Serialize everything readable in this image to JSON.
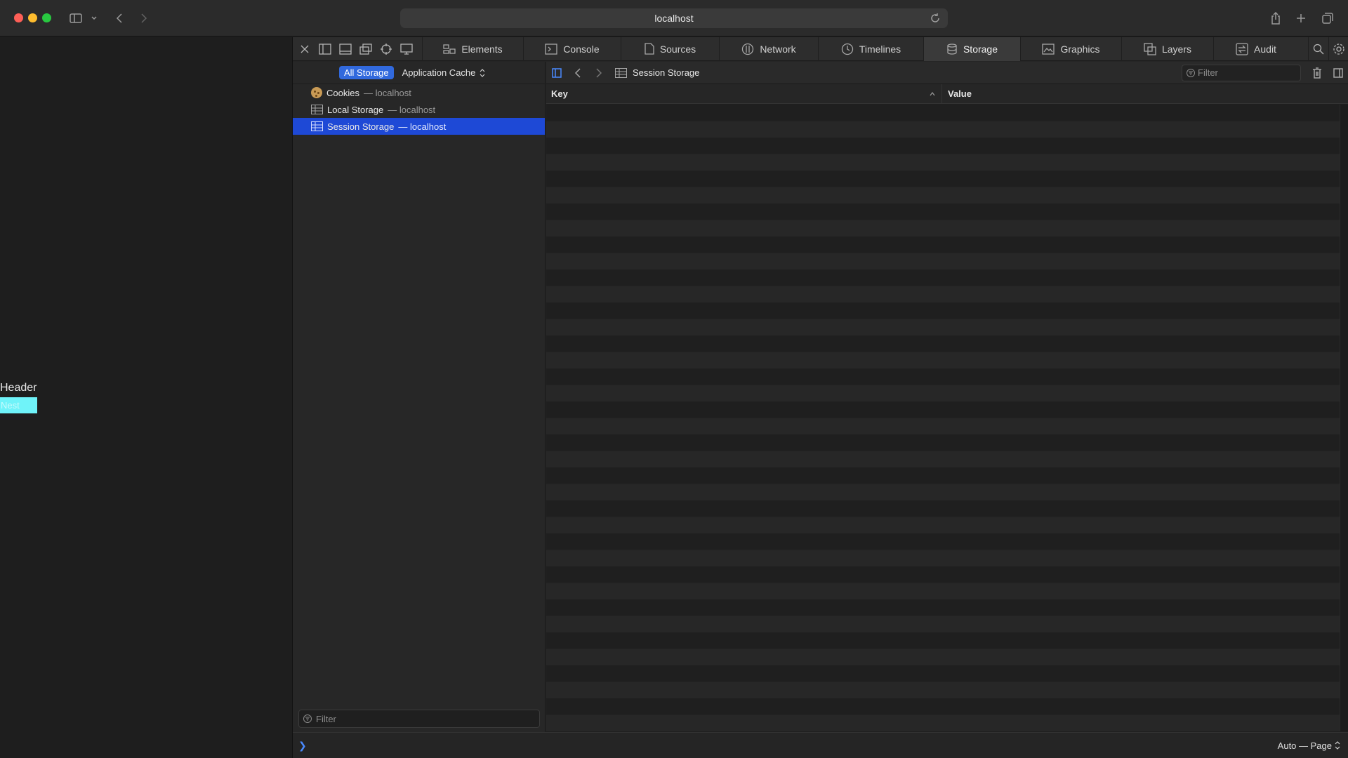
{
  "browser": {
    "url": "localhost"
  },
  "page": {
    "header_text": "Header",
    "nest_text": "Nest"
  },
  "devtools": {
    "tabs": [
      {
        "label": "Elements",
        "icon": "elements-icon"
      },
      {
        "label": "Console",
        "icon": "console-icon"
      },
      {
        "label": "Sources",
        "icon": "sources-icon"
      },
      {
        "label": "Network",
        "icon": "network-icon"
      },
      {
        "label": "Timelines",
        "icon": "timelines-icon"
      },
      {
        "label": "Storage",
        "icon": "storage-icon"
      },
      {
        "label": "Graphics",
        "icon": "graphics-icon"
      },
      {
        "label": "Layers",
        "icon": "layers-icon"
      },
      {
        "label": "Audit",
        "icon": "audit-icon"
      }
    ],
    "active_tab": "Storage",
    "sidebar": {
      "scope_all": "All Storage",
      "scope_select": "Application Cache",
      "items": [
        {
          "label": "Cookies",
          "host": "— localhost"
        },
        {
          "label": "Local Storage",
          "host": "— localhost"
        },
        {
          "label": "Session Storage",
          "host": "— localhost"
        }
      ],
      "selected": "Session Storage",
      "filter_placeholder": "Filter"
    },
    "content": {
      "breadcrumb": "Session Storage",
      "filter_placeholder": "Filter",
      "columns": {
        "key": "Key",
        "value": "Value"
      },
      "rows": []
    },
    "console": {
      "prompt": "❯",
      "mode": "Auto — Page"
    }
  }
}
